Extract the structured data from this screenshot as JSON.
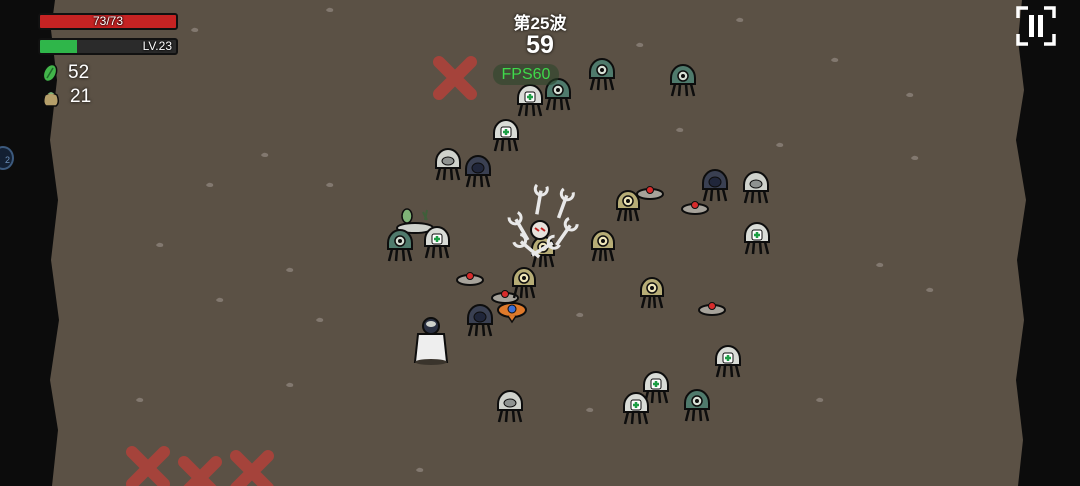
{
  "hud": {
    "hp_text": "73/73",
    "hp_fraction": 1.0,
    "level_text": "LV.23",
    "xp_fraction": 0.27,
    "materials": "52",
    "bag": "21",
    "wave_label": "第25波",
    "timer": "59",
    "fps": "FPS60",
    "side_button_text": "2"
  },
  "colors": {
    "hp": "#c62323",
    "xp": "#2fb64a",
    "ground": "#5b5145",
    "ground_edge": "#0c0c0c",
    "fps_text": "#3fd94a"
  },
  "icons": {
    "materials": "green-leaf-icon",
    "bag": "money-bag-icon",
    "pause": "pause-icon"
  }
}
